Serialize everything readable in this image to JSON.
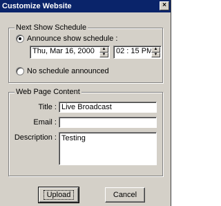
{
  "window": {
    "title": "Customize Website",
    "close_glyph": "×"
  },
  "schedule": {
    "legend": "Next Show Schedule",
    "announce_label": "Announce show schedule :",
    "date_value": "Thu, Mar 16, 2000",
    "time_value": "02 : 15  PM",
    "none_label": "No schedule announced",
    "selected": "announce"
  },
  "content": {
    "legend": "Web Page Content",
    "title_label": "Title :",
    "title_value": "Live Broadcast",
    "email_label": "Email :",
    "email_value": "",
    "description_label": "Description :",
    "description_value": "Testing"
  },
  "buttons": {
    "upload": "Upload",
    "cancel": "Cancel"
  }
}
